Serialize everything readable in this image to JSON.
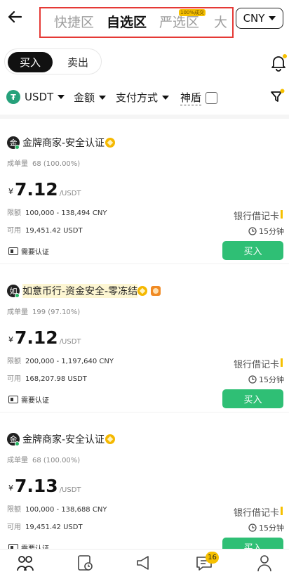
{
  "header": {
    "tabs": [
      {
        "label": "快捷区",
        "active": false
      },
      {
        "label": "自选区",
        "active": true
      },
      {
        "label": "严选区",
        "active": false,
        "badge": "100%成交"
      },
      {
        "label": "大",
        "active": false
      }
    ],
    "currency": "CNY"
  },
  "trade_toggle": {
    "buy": "买入",
    "sell": "卖出"
  },
  "filters": {
    "coin": "USDT",
    "coin_icon_glyph": "₮",
    "amount": "金额",
    "payment": "支付方式",
    "shield": "神盾"
  },
  "ads": [
    {
      "avatar": "金",
      "merchant": "金牌商家-安全认证",
      "orders_label": "成单量",
      "orders": "68 (100.00%)",
      "currency_symbol": "¥",
      "price": "7.12",
      "unit": "/USDT",
      "limit_label": "限额",
      "limit": "100,000 - 138,494 CNY",
      "avail_label": "可用",
      "available": "19,451.42 USDT",
      "payment": "银行借记卡",
      "time": "15分钟",
      "verify": "需要认证",
      "button": "买入"
    },
    {
      "avatar": "如",
      "merchant": "如意币行-资金安全-零冻结",
      "orders_label": "成单量",
      "orders": "199 (97.10%)",
      "currency_symbol": "¥",
      "price": "7.12",
      "unit": "/USDT",
      "limit_label": "限额",
      "limit": "200,000 - 1,197,640 CNY",
      "avail_label": "可用",
      "available": "168,207.98 USDT",
      "payment": "银行借记卡",
      "time": "15分钟",
      "verify": "需要认证",
      "button": "买入"
    },
    {
      "avatar": "金",
      "merchant": "金牌商家-安全认证",
      "orders_label": "成单量",
      "orders": "68 (100.00%)",
      "currency_symbol": "¥",
      "price": "7.13",
      "unit": "/USDT",
      "limit_label": "限额",
      "limit": "100,000 - 138,688 CNY",
      "avail_label": "可用",
      "available": "19,451.42 USDT",
      "payment": "银行借记卡",
      "time": "15分钟",
      "verify": "需要认证",
      "button": "买入"
    }
  ],
  "bottom_nav": {
    "items": [
      "p2p-icon",
      "orders-icon",
      "announcement-icon",
      "chat-icon",
      "profile-icon"
    ],
    "chat_badge": "16"
  },
  "colors": {
    "accent_green": "#2fbf75",
    "highlight_box": "#e53935",
    "badge_yellow": "#f6c000",
    "usdt_green": "#26a17b"
  }
}
